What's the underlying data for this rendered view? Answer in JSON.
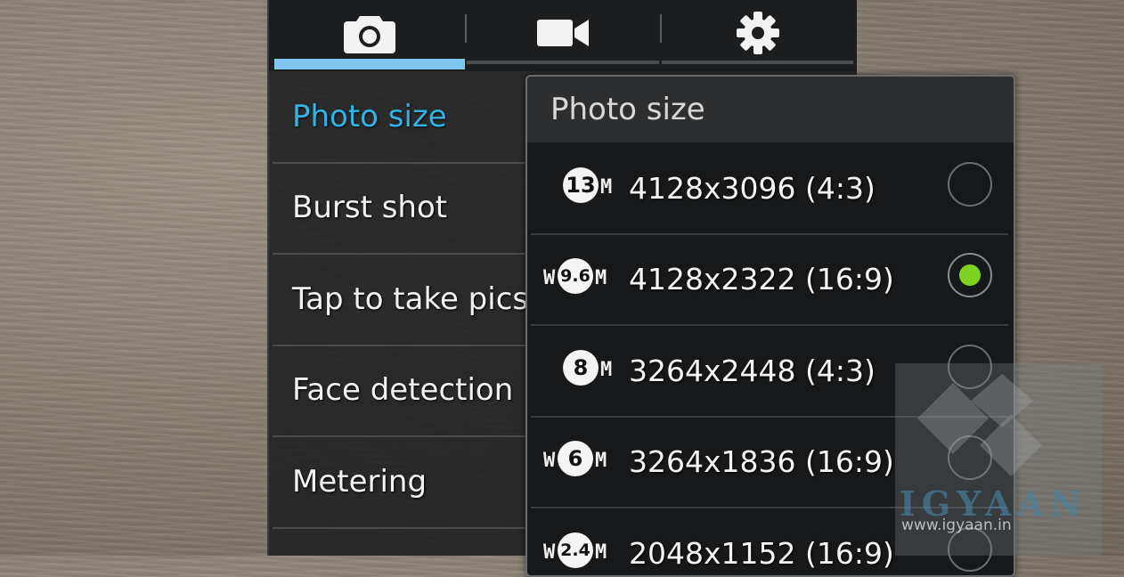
{
  "tabs": [
    {
      "icon": "camera-icon"
    },
    {
      "icon": "video-camera-icon"
    },
    {
      "icon": "gear-icon"
    }
  ],
  "settings_list": {
    "items": [
      {
        "label": "Photo size"
      },
      {
        "label": "Burst shot"
      },
      {
        "label": "Tap to take pics"
      },
      {
        "label": "Face detection"
      },
      {
        "label": "Metering"
      }
    ],
    "active_color": "#31b3e6"
  },
  "dialog": {
    "title": "Photo size",
    "options": [
      {
        "w": "",
        "mp": "13",
        "m": "M",
        "label": "4128x3096 (4:3)",
        "selected": false
      },
      {
        "w": "W",
        "mp": "9.6",
        "m": "M",
        "label": "4128x2322 (16:9)",
        "selected": true
      },
      {
        "w": "",
        "mp": "8",
        "m": "M",
        "label": "3264x2448 (4:3)",
        "selected": false
      },
      {
        "w": "W",
        "mp": "6",
        "m": "M",
        "label": "3264x1836 (16:9)",
        "selected": false
      },
      {
        "w": "W",
        "mp": "2.4",
        "m": "M",
        "label": "2048x1152 (16:9)",
        "selected": false
      }
    ],
    "selected_color": "#7dd21f"
  },
  "watermark": {
    "brand": "IGYAAN",
    "url": "www.igyaan.in"
  }
}
